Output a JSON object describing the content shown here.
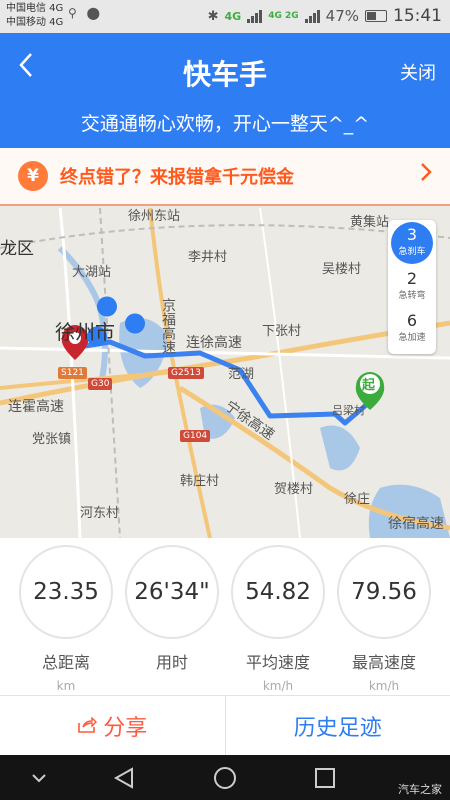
{
  "status_bar": {
    "carrier1": "中国电信 4G",
    "carrier2": "中国移动 4G",
    "net1": "4G",
    "net2": "4G 2G",
    "battery": "47%",
    "time": "15:41"
  },
  "header": {
    "title": "快车手",
    "close_label": "关闭",
    "slogan": "交通通畅心欢畅，开心一整天^_^"
  },
  "banner": {
    "icon": "¥",
    "text": "终点错了？来报错拿千元偿金"
  },
  "map": {
    "labels": {
      "xuzhou_east": "徐州东站",
      "huangjizhen": "黄集站",
      "longqu": "龙区",
      "dahu": "大湖站",
      "lijing": "李井村",
      "wulou": "吴楼村",
      "xuzhou": "徐州市",
      "jingfu": "京福高速",
      "lianxu": "连徐高速",
      "xiazhang": "下张村",
      "fanhu": "范湖",
      "lianhuo": "连霍高速",
      "dangzhang": "党张镇",
      "ningsu": "宁徐高速",
      "lusi": "吕梁村",
      "hanzhuang": "韩庄村",
      "helou": "贺楼村",
      "xuzhuang": "徐庄",
      "hedong": "河东村",
      "xusu": "徐宿高速",
      "s121": "S121",
      "g30": "G30",
      "g2513": "G2513",
      "g104": "G104",
      "start": "起"
    },
    "event_counts": [
      {
        "value": "3",
        "label": "急刹车"
      },
      {
        "value": "2",
        "label": "急转弯"
      },
      {
        "value": "6",
        "label": "急加速"
      }
    ]
  },
  "stats": [
    {
      "value": "23.35",
      "label": "总距离",
      "unit": "km"
    },
    {
      "value": "26'34\"",
      "label": "用时",
      "unit": ""
    },
    {
      "value": "54.82",
      "label": "平均速度",
      "unit": "km/h"
    },
    {
      "value": "79.56",
      "label": "最高速度",
      "unit": "km/h"
    }
  ],
  "actions": {
    "share": "分享",
    "history": "历史足迹"
  },
  "watermark": "汽车之家",
  "colors": {
    "primary": "#2f7df2",
    "accent_orange": "#ff5a1e",
    "route": "#3b82f0"
  }
}
